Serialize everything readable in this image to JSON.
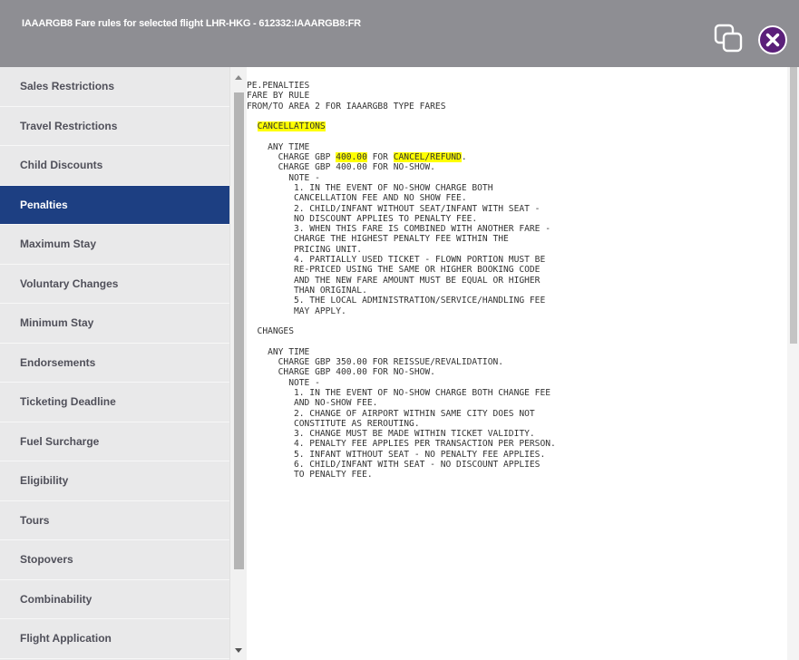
{
  "window": {
    "title": "IAAARGB8 Fare rules for selected flight LHR-HKG - 612332:IAAARGB8:FR",
    "copy_icon": "copy-icon",
    "close_icon": "close-icon",
    "accent_color": "#5b1f7a",
    "titlebar_color": "#8e8e93"
  },
  "sidebar": {
    "active_color": "#1d3f82",
    "items": [
      {
        "label": "Sales Restrictions"
      },
      {
        "label": "Travel Restrictions"
      },
      {
        "label": "Child Discounts"
      },
      {
        "label": "Penalties",
        "active": true
      },
      {
        "label": "Maximum Stay"
      },
      {
        "label": "Voluntary Changes"
      },
      {
        "label": "Minimum Stay"
      },
      {
        "label": "Endorsements"
      },
      {
        "label": "Ticketing Deadline"
      },
      {
        "label": "Fuel Surcharge"
      },
      {
        "label": "Eligibility"
      },
      {
        "label": "Tours"
      },
      {
        "label": "Stopovers"
      },
      {
        "label": "Combinability"
      },
      {
        "label": "Flight Application"
      }
    ]
  },
  "content": {
    "highlight_color": "#ffff00",
    "lines": [
      "PE.PENALTIES",
      "FARE BY RULE",
      "FROM/TO AREA 2 FOR IAAARGB8 TYPE FARES",
      "",
      "  CANCELLATIONS",
      "",
      "    ANY TIME",
      "      CHARGE GBP 400.00 FOR CANCEL/REFUND.",
      "      CHARGE GBP 400.00 FOR NO-SHOW.",
      "        NOTE -",
      "         1. IN THE EVENT OF NO-SHOW CHARGE BOTH",
      "         CANCELLATION FEE AND NO SHOW FEE.",
      "         2. CHILD/INFANT WITHOUT SEAT/INFANT WITH SEAT -",
      "         NO DISCOUNT APPLIES TO PENALTY FEE.",
      "         3. WHEN THIS FARE IS COMBINED WITH ANOTHER FARE -",
      "         CHARGE THE HIGHEST PENALTY FEE WITHIN THE",
      "         PRICING UNIT.",
      "         4. PARTIALLY USED TICKET - FLOWN PORTION MUST BE",
      "         RE-PRICED USING THE SAME OR HIGHER BOOKING CODE",
      "         AND THE NEW FARE AMOUNT MUST BE EQUAL OR HIGHER",
      "         THAN ORIGINAL.",
      "         5. THE LOCAL ADMINISTRATION/SERVICE/HANDLING FEE",
      "         MAY APPLY.",
      "",
      "  CHANGES",
      "",
      "    ANY TIME",
      "      CHARGE GBP 350.00 FOR REISSUE/REVALIDATION.",
      "      CHARGE GBP 400.00 FOR NO-SHOW.",
      "        NOTE -",
      "         1. IN THE EVENT OF NO-SHOW CHARGE BOTH CHANGE FEE",
      "         AND NO-SHOW FEE.",
      "         2. CHANGE OF AIRPORT WITHIN SAME CITY DOES NOT",
      "         CONSTITUTE AS REROUTING.",
      "         3. CHANGE MUST BE MADE WITHIN TICKET VALIDITY.",
      "         4. PENALTY FEE APPLIES PER TRANSACTION PER PERSON.",
      "         5. INFANT WITHOUT SEAT - NO PENALTY FEE APPLIES.",
      "         6. CHILD/INFANT WITH SEAT - NO DISCOUNT APPLIES",
      "         TO PENALTY FEE."
    ],
    "highlights": [
      {
        "line": 4,
        "text": "CANCELLATIONS"
      },
      {
        "line": 7,
        "text": "400.00"
      },
      {
        "line": 7,
        "text": "CANCEL/REFUND"
      }
    ]
  }
}
